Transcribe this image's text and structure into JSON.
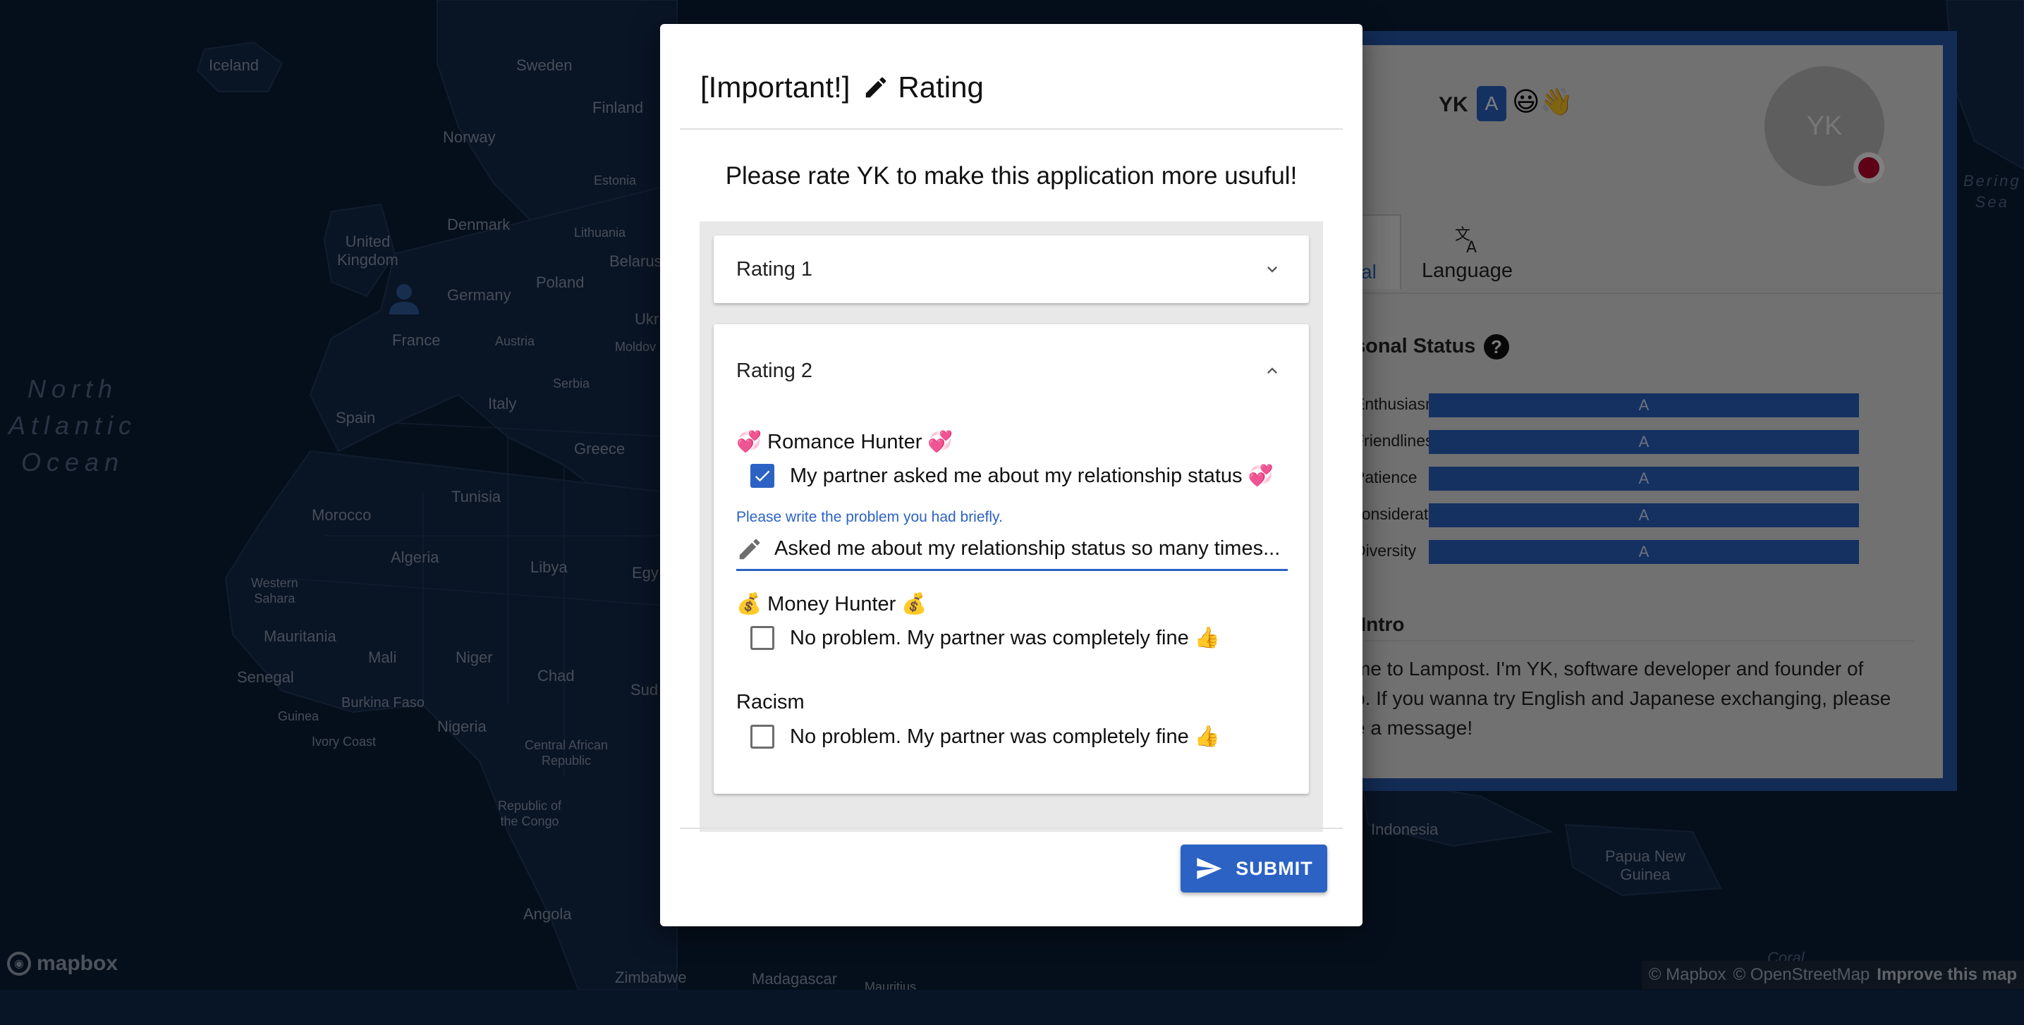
{
  "map": {
    "labels": {
      "iceland": "Iceland",
      "sweden": "Sweden",
      "finland": "Finland",
      "norway": "Norway",
      "estonia": "Estonia",
      "denmark": "Denmark",
      "lithuania": "Lithuania",
      "united_kingdom": "United\nKingdom",
      "belarus": "Belarus",
      "poland": "Poland",
      "germany": "Germany",
      "ukraine": "Ukr",
      "france": "France",
      "austria": "Austria",
      "moldova": "Moldov",
      "serbia": "Serbia",
      "spain": "Spain",
      "italy": "Italy",
      "greece": "Greece",
      "tunisia": "Tunisia",
      "morocco": "Morocco",
      "algeria": "Algeria",
      "libya": "Libya",
      "egypt": "Egy",
      "western_sahara": "Western\nSahara",
      "mauritania": "Mauritania",
      "mali": "Mali",
      "niger": "Niger",
      "chad": "Chad",
      "sudan": "Sud",
      "senegal": "Senegal",
      "guinea": "Guinea",
      "burkina_faso": "Burkina Faso",
      "ivory_coast": "Ivory Coast",
      "nigeria": "Nigeria",
      "car": "Central African\nRepublic",
      "congo": "Republic of\nthe Congo",
      "angola": "Angola",
      "zimbabwe": "Zimbabwe",
      "madagascar": "Madagascar",
      "mauritius": "Mauritius",
      "indonesia": "Indonesia",
      "papua": "Papua New\nGuinea",
      "coral": "Coral",
      "bering": "Bering\nSea",
      "north_atlantic": "North\nAtlantic\nOcean"
    },
    "logo": "mapbox",
    "attribution": {
      "mapbox": "© Mapbox",
      "osm": "© OpenStreetMap",
      "improve": "Improve this map"
    }
  },
  "profile": {
    "name": "YK",
    "badge": "A",
    "emoji": "😃👋",
    "avatar": "YK",
    "tab_personal": "al",
    "tab_language": "Language",
    "status_title": "sonal Status",
    "help": "?",
    "stats": [
      {
        "label": "Enthusiasm",
        "grade": "A"
      },
      {
        "label": "Friendliness",
        "grade": "A"
      },
      {
        "label": "Patience",
        "grade": "A"
      },
      {
        "label": "Consideration",
        "grade": "A"
      },
      {
        "label": "Diversity",
        "grade": "A"
      }
    ],
    "intro_title": "-Intro",
    "intro_text": "me to Lampost. I'm YK, software developer and founder of\np. If you wanna try English and Japanese exchanging, please\ne a message!"
  },
  "dialog": {
    "title_prefix": "[Important!]",
    "title": "Rating",
    "subtitle": "Please rate YK to make this application more usuful!",
    "accordions": [
      {
        "label": "Rating 1",
        "expanded": false
      },
      {
        "label": "Rating 2",
        "expanded": true
      }
    ],
    "sections": [
      {
        "title": "💞 Romance Hunter 💞",
        "option": "My partner asked me about my relationship status 💞",
        "checked": true
      },
      {
        "title": "💰 Money Hunter 💰",
        "option": "No problem. My partner was completely fine 👍",
        "checked": false
      },
      {
        "title": "Racism",
        "option": "No problem. My partner was completely fine 👍",
        "checked": false
      }
    ],
    "problem_helper": "Please write the problem you had briefly.",
    "problem_value": "Asked me about my relationship status so many times...",
    "submit_label": "SUBMIT"
  },
  "colors": {
    "accent": "#2b62c4",
    "map_water": "#0b1e38",
    "map_land": "#13294a"
  }
}
